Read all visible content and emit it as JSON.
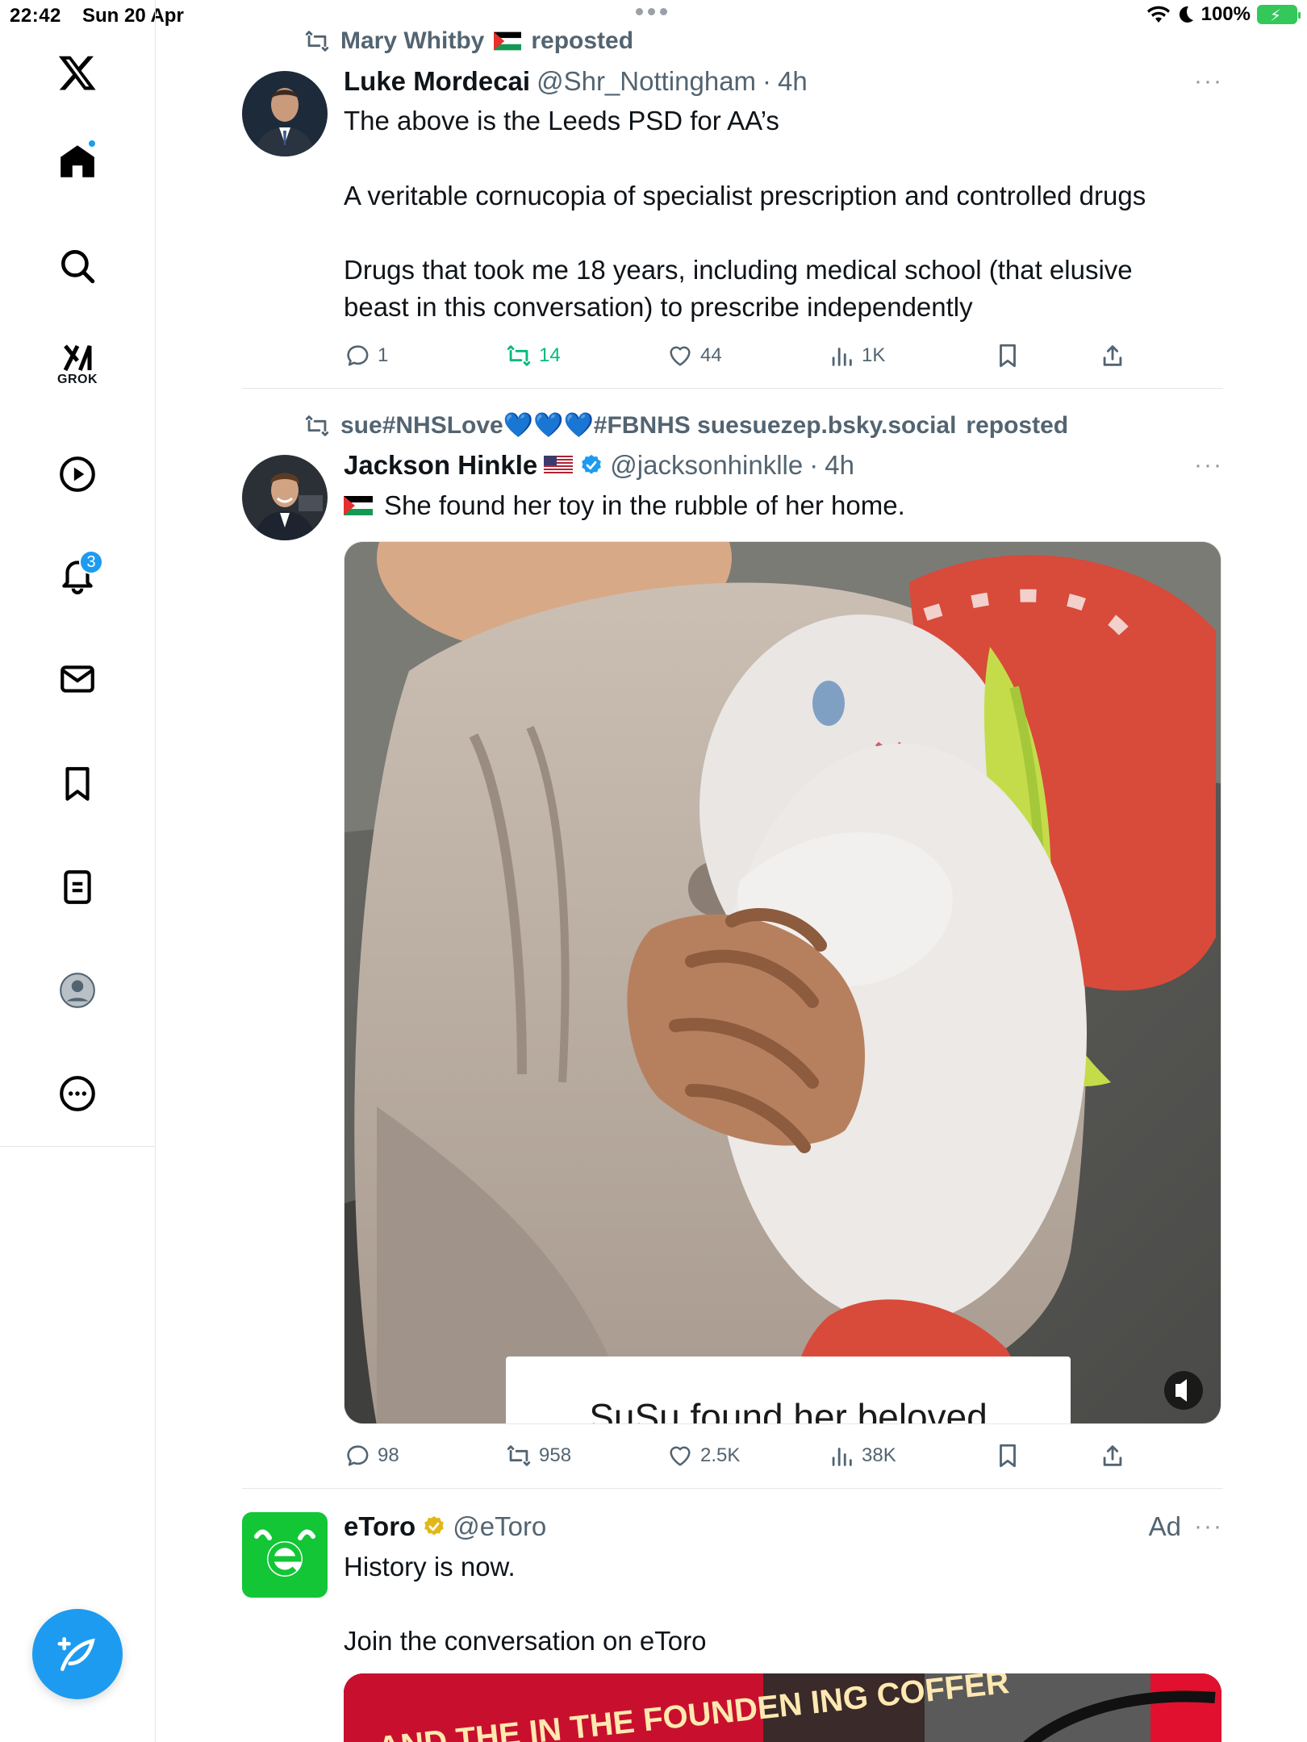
{
  "status_bar": {
    "time": "22:42",
    "date": "Sun 20 Apr",
    "battery": "100%"
  },
  "sidebar": {
    "items": [
      {
        "name": "x-logo",
        "label": ""
      },
      {
        "name": "home",
        "label": ""
      },
      {
        "name": "search",
        "label": ""
      },
      {
        "name": "grok",
        "label": "GROK"
      },
      {
        "name": "video",
        "label": ""
      },
      {
        "name": "notifications",
        "label": "",
        "badge": "3"
      },
      {
        "name": "messages",
        "label": ""
      },
      {
        "name": "bookmarks",
        "label": ""
      },
      {
        "name": "lists",
        "label": ""
      },
      {
        "name": "profile",
        "label": ""
      },
      {
        "name": "more",
        "label": ""
      }
    ]
  },
  "posts": [
    {
      "repost_by": "Mary Whitby",
      "repost_suffix": "reposted",
      "name": "Luke Mordecai",
      "handle": "@Shr_Nottingham",
      "separator": "·",
      "time": "4h",
      "lines": [
        "The above is the Leeds PSD for AA’s",
        "A veritable cornucopia of specialist prescription and controlled drugs",
        "Drugs that took me 18 years, including medical school (that elusive",
        "beast in this conversation) to prescribe independently"
      ],
      "replies": "1",
      "reposts": "14",
      "likes": "44",
      "views": "1K"
    },
    {
      "repost_by": "sue#NHSLove💙💙💙#FBNHS suesuezep.bsky.social",
      "repost_suffix": "reposted",
      "name": "Jackson Hinkle",
      "handle": "@jacksonhinklle",
      "separator": "·",
      "time": "4h",
      "lines": [
        "She found her toy in the rubble of her home."
      ],
      "media_caption": "SuSu found her beloved",
      "replies": "98",
      "reposts": "958",
      "likes": "2.5K",
      "views": "38K"
    },
    {
      "name": "eToro",
      "handle": "@eToro",
      "ad_label": "Ad",
      "lines": [
        "History is now.",
        "Join the conversation on eToro"
      ],
      "media_text": "AND THE IN THE FOUNDEN ING COFFER"
    }
  ],
  "colors": {
    "accent": "#1d9bf0",
    "repost_green": "#00ba7c",
    "secondary_text": "#536471",
    "etoro_green": "#13c636"
  }
}
